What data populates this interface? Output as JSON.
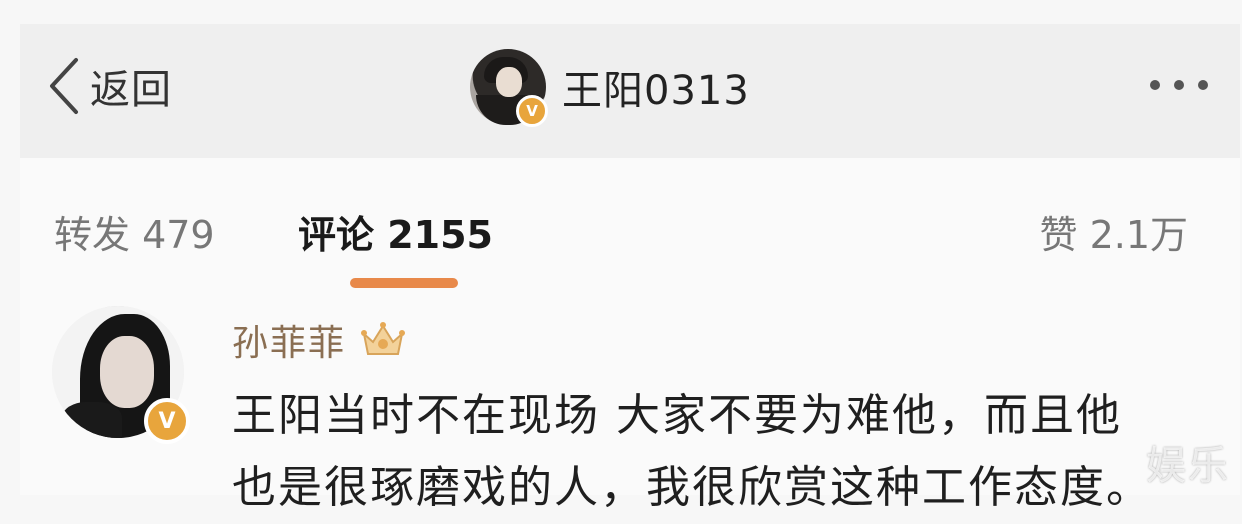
{
  "header": {
    "back_label": "返回",
    "username": "王阳0313",
    "avatar_badge": "V",
    "more_icon": "more-horizontal-icon"
  },
  "tabs": {
    "repost": "转发 479",
    "comment": "评论 2155",
    "like": "赞 2.1万",
    "active_color": "#e8894a"
  },
  "comment": {
    "username": "孙菲菲",
    "badge_icon": "crown-badge-icon",
    "avatar_badge": "V",
    "text": "王阳当时不在现场 大家不要为难他，而且他\n也是很琢磨戏的人，我很欣赏这种工作态度。"
  },
  "watermark": "娱乐",
  "colors": {
    "username_color": "#8a6e52",
    "verified_badge": "#e8a53c"
  }
}
